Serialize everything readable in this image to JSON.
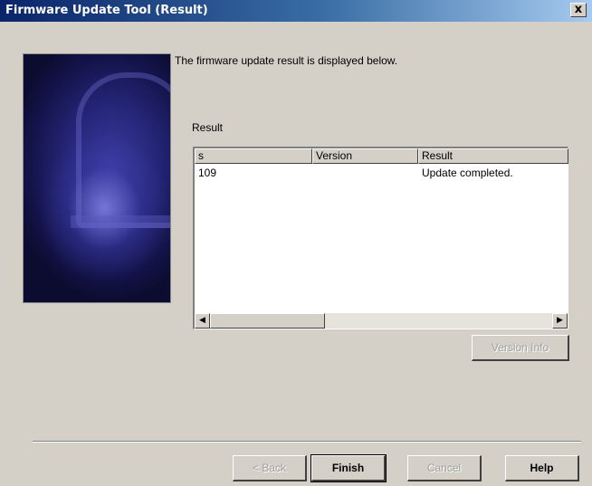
{
  "window": {
    "title": "Firmware Update Tool (Result)",
    "close_glyph": "x"
  },
  "intro_text": "The firmware update result is displayed below.",
  "result_label": "Result",
  "table": {
    "columns": [
      "s",
      "Version",
      "Result"
    ],
    "rows": [
      {
        "s": "109",
        "version": "",
        "result": "Update completed."
      }
    ],
    "scroll_left_glyph": "◀",
    "scroll_right_glyph": "▶"
  },
  "buttons": {
    "version_info": "Version Info",
    "back": "< Back",
    "finish": "Finish",
    "cancel": "Cancel",
    "help": "Help"
  },
  "colors": {
    "titlebar_start": "#0a246a",
    "titlebar_end": "#a6caf0",
    "dialog_bg": "#d4d0c8"
  }
}
